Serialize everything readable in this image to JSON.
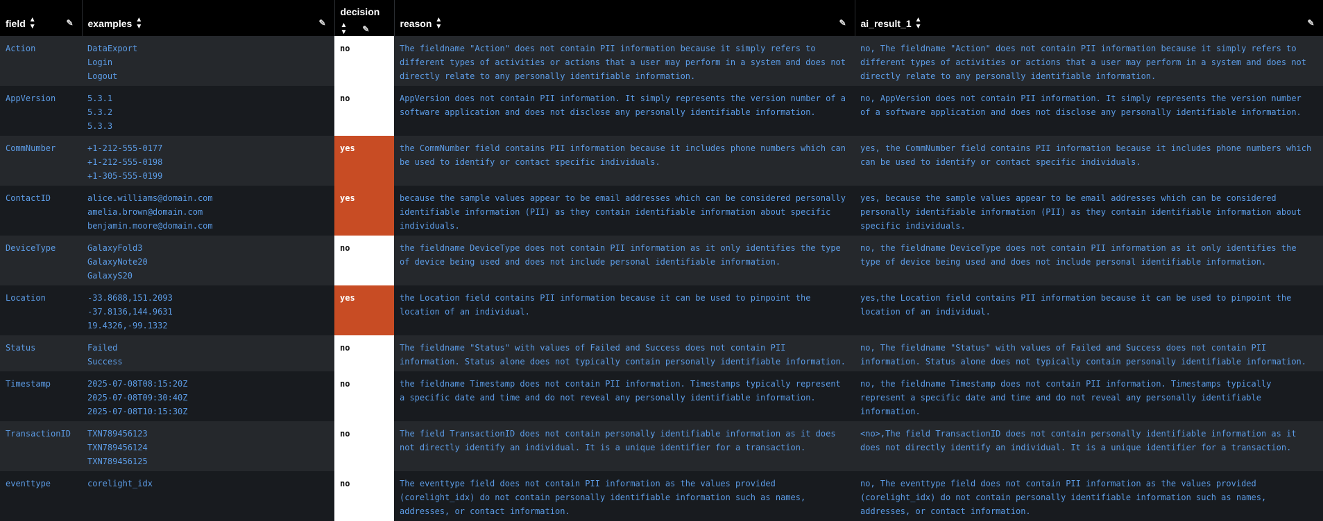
{
  "columns": {
    "field": "field",
    "examples": "examples",
    "decision": "decision",
    "reason": "reason",
    "ai_result": "ai_result_1"
  },
  "rows": [
    {
      "field": "Action",
      "examples": [
        "DataExport",
        "Login",
        "Logout"
      ],
      "decision": "no",
      "reason": "The fieldname \"Action\" does not contain PII information because it simply refers to different types of activities or actions that a user may perform in a system and does not directly relate to any personally identifiable information.",
      "ai_result": "no, The fieldname \"Action\" does not contain PII information because it simply refers to different types of activities or actions that a user may perform in a system and does not directly relate to any personally identifiable information."
    },
    {
      "field": "AppVersion",
      "examples": [
        "5.3.1",
        "5.3.2",
        "5.3.3"
      ],
      "decision": "no",
      "reason": "AppVersion does not contain PII information. It simply represents the version number of a software application and does not disclose any personally identifiable information.",
      "ai_result": "no, AppVersion does not contain PII information. It simply represents the version number of a software application and does not disclose any personally identifiable information."
    },
    {
      "field": "CommNumber",
      "examples": [
        "+1-212-555-0177",
        "+1-212-555-0198",
        "+1-305-555-0199"
      ],
      "decision": "yes",
      "reason": "the CommNumber field contains PII information because it includes phone numbers which can be used to identify or contact specific individuals.",
      "ai_result": "yes, the CommNumber field contains PII information because it includes phone numbers which can be used to identify or contact specific individuals."
    },
    {
      "field": "ContactID",
      "examples": [
        "alice.williams@domain.com",
        "amelia.brown@domain.com",
        "benjamin.moore@domain.com"
      ],
      "decision": "yes",
      "reason": "because the sample values appear to be email addresses which can be considered personally identifiable information (PII) as they contain identifiable information about specific individuals.",
      "ai_result": "yes, because the sample values appear to be email addresses which can be considered personally identifiable information (PII) as they contain identifiable information about specific individuals."
    },
    {
      "field": "DeviceType",
      "examples": [
        "GalaxyFold3",
        "GalaxyNote20",
        "GalaxyS20"
      ],
      "decision": "no",
      "reason": "the fieldname DeviceType does not contain PII information as it only identifies the type of device being used and does not include personal identifiable information.",
      "ai_result": "no, the fieldname DeviceType does not contain PII information as it only identifies the type of device being used and does not include personal identifiable information."
    },
    {
      "field": "Location",
      "examples": [
        "-33.8688,151.2093",
        "-37.8136,144.9631",
        "19.4326,-99.1332"
      ],
      "decision": "yes",
      "reason": "the Location field contains PII information because it can be used to pinpoint the location of an individual.",
      "ai_result": "yes,the Location field contains PII information because it can be used to pinpoint the location of an individual."
    },
    {
      "field": "Status",
      "examples": [
        "Failed",
        "Success"
      ],
      "decision": "no",
      "reason": "The fieldname \"Status\" with values of Failed and Success does not contain PII information. Status alone does not typically contain personally identifiable information.",
      "ai_result": "no, The fieldname \"Status\" with values of Failed and Success does not contain PII information. Status alone does not typically contain personally identifiable information."
    },
    {
      "field": "Timestamp",
      "examples": [
        "2025-07-08T08:15:20Z",
        "2025-07-08T09:30:40Z",
        "2025-07-08T10:15:30Z"
      ],
      "decision": "no",
      "reason": "the fieldname Timestamp does not contain PII information. Timestamps typically represent a specific date and time and do not reveal any personally identifiable information.",
      "ai_result": "no, the fieldname Timestamp does not contain PII information. Timestamps typically represent a specific date and time and do not reveal any personally identifiable information."
    },
    {
      "field": "TransactionID",
      "examples": [
        "TXN789456123",
        "TXN789456124",
        "TXN789456125"
      ],
      "decision": "no",
      "reason": "The field TransactionID does not contain personally identifiable information as it does not directly identify an individual. It is a unique identifier for a transaction.",
      "ai_result": "<no>,The field TransactionID does not contain personally identifiable information as it does not directly identify an individual. It is a unique identifier for a transaction."
    },
    {
      "field": "eventtype",
      "examples": [
        "corelight_idx"
      ],
      "decision": "no",
      "reason": "The eventtype field does not contain PII information as the values provided (corelight_idx) do not contain personally identifiable information such as names, addresses, or contact information.",
      "ai_result": "no, The eventtype field does not contain PII information as the values provided (corelight_idx) do not contain personally identifiable information such as names, addresses, or contact information."
    }
  ],
  "icons": {
    "sort": "sort-icon",
    "edit": "pencil-icon"
  },
  "colors": {
    "header_bg": "#000000",
    "row_odd": "#25282c",
    "row_even": "#181b1f",
    "text_link": "#5c9ce6",
    "yes_bg": "#c84c24",
    "no_bg": "#ffffff"
  }
}
